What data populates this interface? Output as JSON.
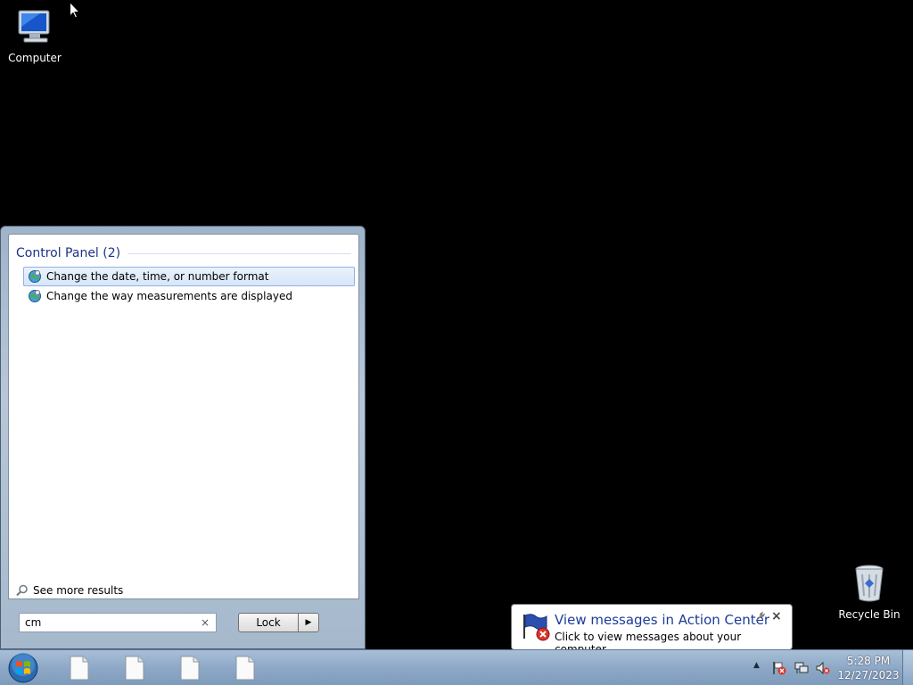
{
  "desktop": {
    "icons": [
      {
        "label": "Computer"
      },
      {
        "label": "Recycle Bin"
      }
    ]
  },
  "start_menu": {
    "group_title": "Control Panel (2)",
    "results": [
      {
        "label": "Change the date, time, or number format",
        "selected": true
      },
      {
        "label": "Change the way measurements are displayed",
        "selected": false
      }
    ],
    "see_more": "See more results",
    "search": {
      "value": "cm",
      "clear": "×"
    },
    "power_button": {
      "label": "Lock",
      "arrow": "▶"
    }
  },
  "notification": {
    "title": "View messages in Action Center",
    "body": "Click to view messages about your computer.",
    "close": "×"
  },
  "taskbar": {
    "tray_chevron": "▲",
    "clock": {
      "time": "5:28 PM",
      "date": "12/27/2023"
    }
  },
  "colors": {
    "accent": "#1b3d9a",
    "taskbar": "#8ea9c7",
    "selection": "#d7e6f8"
  }
}
